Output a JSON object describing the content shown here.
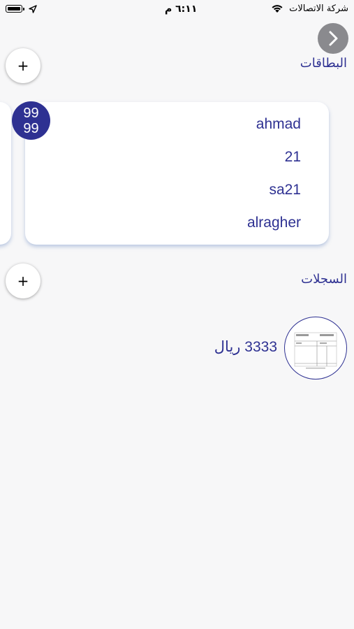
{
  "status_bar": {
    "carrier": "شركة الاتصالات",
    "time": "٦:١١ م",
    "battery_icon": "battery-icon",
    "location_icon": "location-arrow-icon",
    "wifi_icon": "wifi-icon"
  },
  "header": {
    "back_icon": "chevron-right-icon"
  },
  "cards_section": {
    "title": "البطاقات",
    "add_label": "+"
  },
  "card": {
    "lines": [
      "ahmad",
      "21",
      "sa21",
      "alragher"
    ],
    "badge_top": "99",
    "badge_bottom": "99"
  },
  "records_section": {
    "title": "السجلات",
    "add_label": "+"
  },
  "records": [
    {
      "amount": "3333 ريال",
      "thumbnail_icon": "invoice-thumbnail"
    }
  ],
  "colors": {
    "primary": "#2e3192",
    "background": "#f7f7f8",
    "back_button": "#8a8a8e"
  }
}
